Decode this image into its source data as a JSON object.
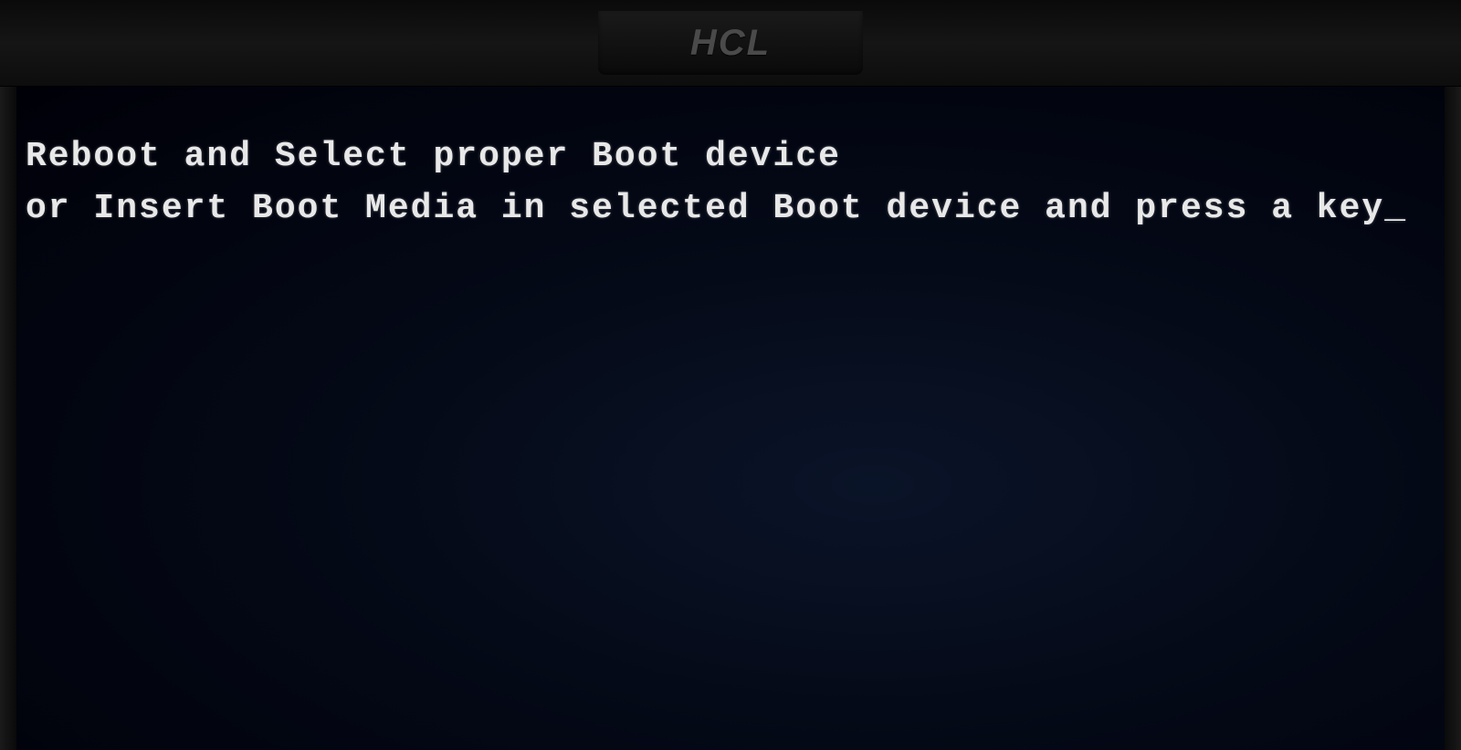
{
  "monitor": {
    "brand": "HCL"
  },
  "bios": {
    "line1": "Reboot and Select proper Boot device",
    "line2": "or Insert Boot Media in selected Boot device and press a key",
    "cursor": "_"
  }
}
